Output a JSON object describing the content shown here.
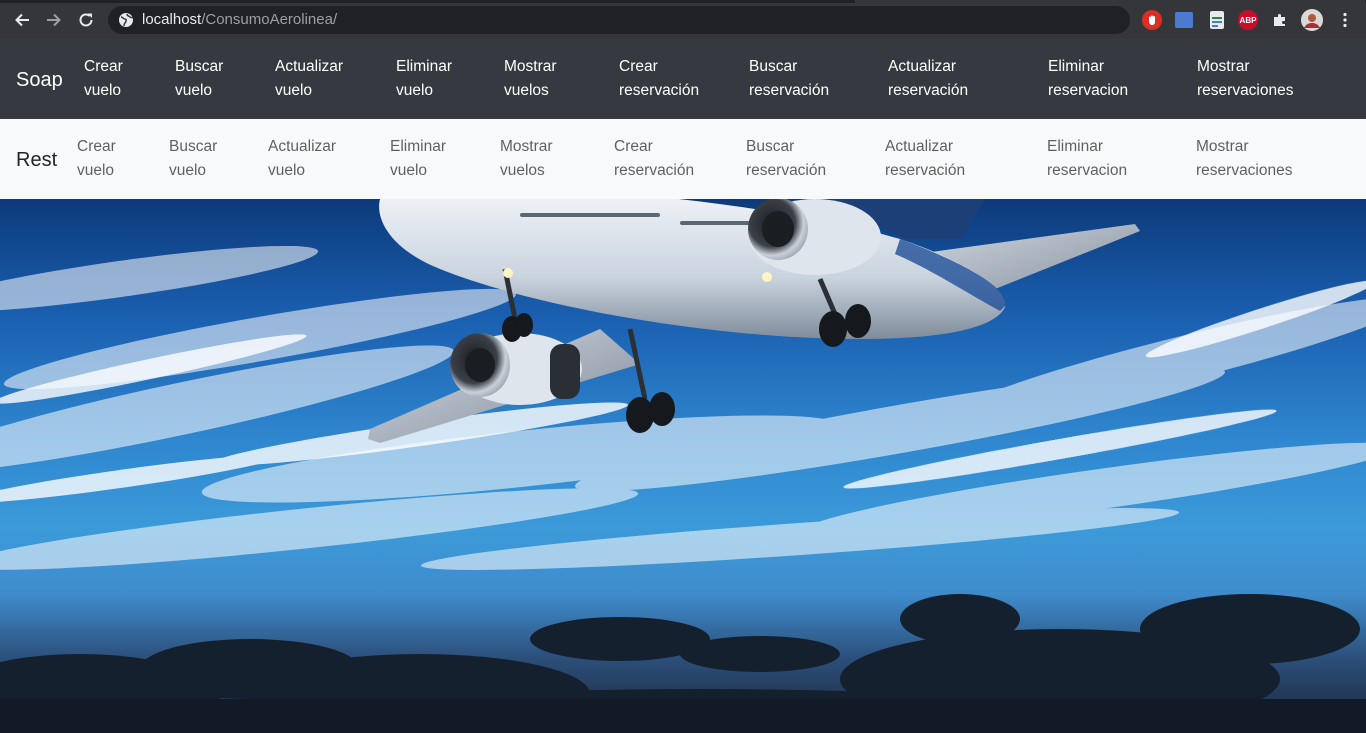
{
  "browser": {
    "url_host": "localhost",
    "url_path": "/ConsumoAerolinea/",
    "extensions": [
      {
        "name": "hand-stop-extension-icon",
        "color": "#d93025"
      },
      {
        "name": "cast-extension-icon",
        "color": "#4a7bd0"
      },
      {
        "name": "sheet-extension-icon",
        "color": "#e8eaed"
      },
      {
        "name": "adblock-plus-extension-icon",
        "label": "ABP",
        "color": "#c70d2c"
      },
      {
        "name": "puzzle-extensions-icon",
        "color": "#e8eaed"
      },
      {
        "name": "profile-avatar-icon",
        "color": "#c0392b"
      }
    ]
  },
  "soap_nav": {
    "brand": "Soap",
    "links": [
      "Crear\nvuelo",
      "Buscar\nvuelo",
      "Actualizar\nvuelo",
      "Eliminar\nvuelo",
      "Mostrar\nvuelos",
      "Crear\nreservación",
      "Buscar\nreservación",
      "Actualizar\nreservación",
      "Eliminar\nreservacion",
      "Mostrar\nreservaciones"
    ]
  },
  "rest_nav": {
    "brand": "Rest",
    "links": [
      "Crear\nvuelo",
      "Buscar\nvuelo",
      "Actualizar\nvuelo",
      "Eliminar\nvuelo",
      "Mostrar\nvuelos",
      "Crear\nreservación",
      "Buscar\nreservación",
      "Actualizar\nreservación",
      "Eliminar\nreservacion",
      "Mostrar\nreservaciones"
    ]
  },
  "hero": {
    "image": "airplane-in-sky-image"
  }
}
